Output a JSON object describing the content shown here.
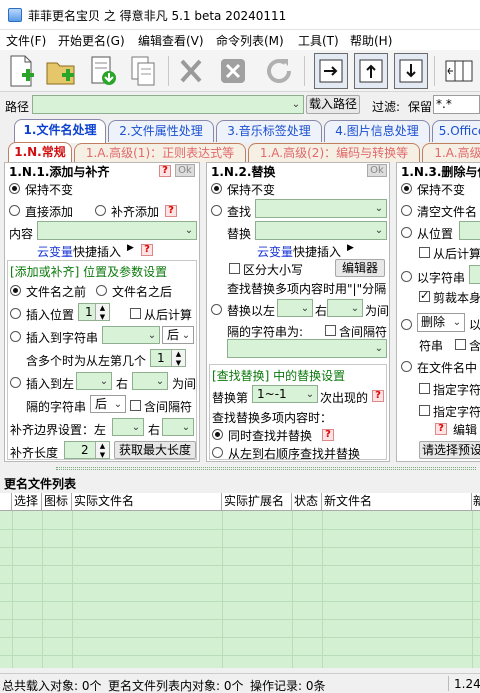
{
  "window": {
    "title": "菲菲更名宝贝 之 得意非凡 5.1 beta 20240111"
  },
  "menu": [
    "文件(F)",
    "开始更名(G)",
    "编辑查看(V)",
    "命令列表(M)",
    "工具(T)",
    "帮助(H)"
  ],
  "toolbar_icons": [
    "new-file-icon",
    "open-folder-icon",
    "import-icon",
    "copy-icon",
    "delete-x-icon",
    "close-box-icon",
    "refresh-icon",
    "arrow-right-box-icon",
    "arrow-up-box-icon",
    "arrow-down-box-icon",
    "columns-icon"
  ],
  "pathbar": {
    "label": "路径",
    "value": "",
    "load_button": "载入路径",
    "filter_label": "过滤:",
    "filter_mode": "保留",
    "filter_value": "*.*"
  },
  "tabs_main": [
    "1.文件名处理",
    "2.文件属性处理",
    "3.音乐标签处理",
    "4.图片信息处理",
    "5.Office"
  ],
  "tabs_sub": [
    "1.N.常规",
    "1.A.高级(1)：正则表达式等",
    "1.A.高级(2)：编码与转换等",
    "1.A.高级"
  ],
  "panel1": {
    "title": "1.N.1.添加与补齐",
    "ok": "Ok",
    "keep": "保持不变",
    "direct_add": "直接添加",
    "pad_add": "补齐添加",
    "content_label": "内容",
    "cloud_var": "云变量",
    "quick_insert": "快捷插入",
    "group_title": "[添加或补齐] 位置及参数设置",
    "before_name": "文件名之前",
    "after_name": "文件名之后",
    "insert_pos": "插入位置",
    "insert_pos_value": "1",
    "from_back": "从后计算",
    "insert_to_str": "插入到字符串",
    "after": "后",
    "multi_note": "含多个时为从左第几个",
    "multi_value": "1",
    "insert_left": "插入到左",
    "right": "右",
    "between": "为间",
    "sep_str": "隔的字符串",
    "sep_mode": "后",
    "include_sep": "含间隔符",
    "pad_border": "补齐边界设置：左",
    "pad_right": "右",
    "pad_length": "补齐长度",
    "pad_length_value": "2",
    "get_max": "获取最大长度"
  },
  "panel2": {
    "title": "1.N.2.替换",
    "ok": "Ok",
    "keep": "保持不变",
    "find": "查找",
    "replace": "替换",
    "cloud_var": "云变量",
    "quick_insert": "快捷插入",
    "case": "区分大小写",
    "editor": "编辑器",
    "multi_note": "查找替换多项内容时用\"|\"分隔",
    "replace_left": "替换以左",
    "right": "右",
    "between": "为间",
    "sep_str": "隔的字符串为:",
    "include_sep": "含间隔符",
    "group_title": "[查找替换] 中的替换设置",
    "replace_nth": "替换第",
    "nth_value": "1~-1",
    "occurrence": "次出现的",
    "multi_mode": "查找替换多项内容时：",
    "simultaneous": "同时查找并替换",
    "sequential": "从左到右顺序查找并替换"
  },
  "panel3": {
    "title": "1.N.3.删除与保",
    "keep": "保持不变",
    "clear_name": "清空文件名",
    "from_pos": "从位置",
    "from_back": "从后计算",
    "by_str": "以字符串",
    "trim_self": "剪裁本身",
    "delete": "删除",
    "by": "以",
    "str": "符串",
    "include": "含",
    "in_name": "在文件名中",
    "specify1": "指定字符",
    "specify2": "指定字符",
    "edit": "编辑",
    "preset": "请选择预设"
  },
  "list": {
    "title": "更名文件列表",
    "columns": [
      "选择",
      "图标",
      "实际文件名",
      "实际扩展名",
      "状态",
      "新文件名",
      "新"
    ]
  },
  "status": {
    "total": "总共载入对象: 0个",
    "in_list": "更名文件列表内对象: 0个",
    "ops": "操作记录: 0条",
    "right": "1.24("
  }
}
